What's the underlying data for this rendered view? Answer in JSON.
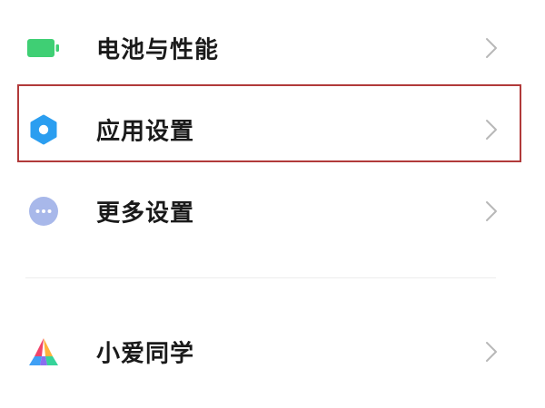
{
  "settings": {
    "items": [
      {
        "label": "电池与性能",
        "icon": "battery-icon"
      },
      {
        "label": "应用设置",
        "icon": "gear-icon"
      },
      {
        "label": "更多设置",
        "icon": "more-dots-icon"
      },
      {
        "label": "小爱同学",
        "icon": "xiaoai-icon"
      }
    ]
  },
  "colors": {
    "battery_green": "#3fcf74",
    "gear_blue": "#2b9ef0",
    "more_bg": "#a8b8ea",
    "highlight_border": "#b13a3a",
    "chevron": "#b8b8b8"
  }
}
